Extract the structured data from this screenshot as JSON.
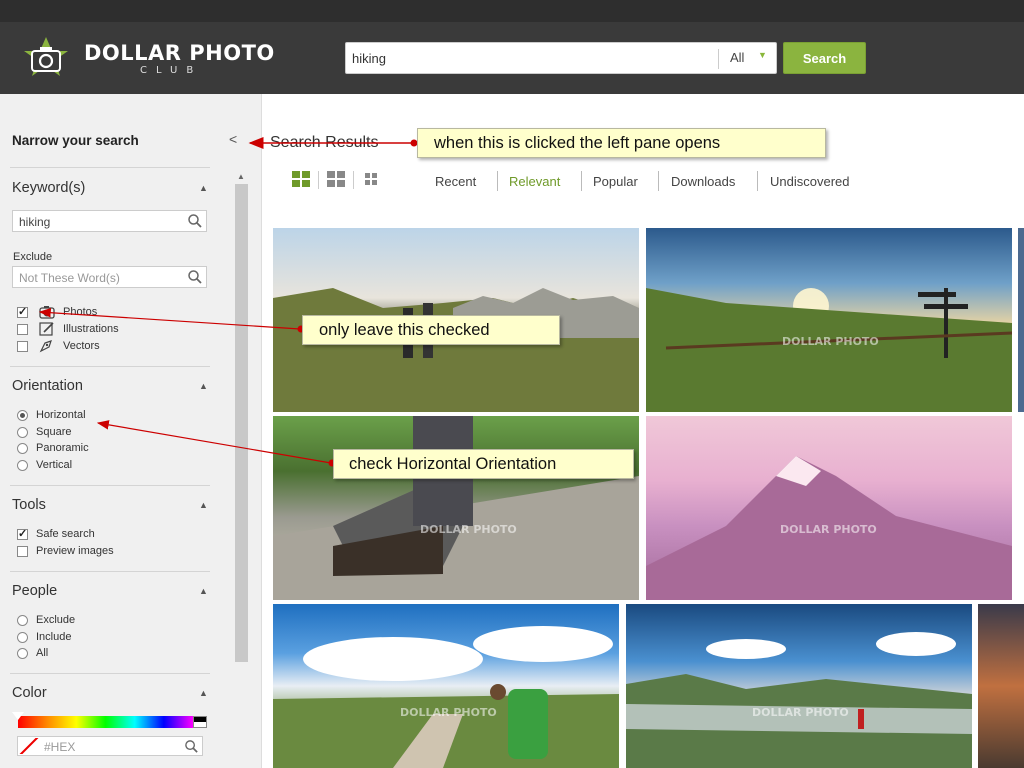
{
  "header": {
    "logo_title": "DOLLAR PHOTO",
    "logo_sub": "CLUB",
    "search_value": "hiking",
    "category_value": "All",
    "search_button": "Search"
  },
  "sidebar": {
    "title": "Narrow your search",
    "keywords": {
      "title": "Keyword(s)",
      "value": "hiking",
      "exclude_label": "Exclude",
      "exclude_placeholder": "Not These Word(s)"
    },
    "types": [
      {
        "label": "Photos",
        "checked": true,
        "icon": "camera-icon"
      },
      {
        "label": "Illustrations",
        "checked": false,
        "icon": "pencil-icon"
      },
      {
        "label": "Vectors",
        "checked": false,
        "icon": "pen-nib-icon"
      }
    ],
    "orientation": {
      "title": "Orientation",
      "options": [
        "Horizontal",
        "Square",
        "Panoramic",
        "Vertical"
      ],
      "selected": "Horizontal"
    },
    "tools": {
      "title": "Tools",
      "options": [
        {
          "label": "Safe search",
          "checked": true
        },
        {
          "label": "Preview images",
          "checked": false
        }
      ]
    },
    "people": {
      "title": "People",
      "options": [
        "Exclude",
        "Include",
        "All"
      ]
    },
    "color": {
      "title": "Color",
      "hex_placeholder": "#HEX"
    }
  },
  "main": {
    "title": "Search Results",
    "sort_options": [
      "Recent",
      "Relevant",
      "Popular",
      "Downloads",
      "Undiscovered"
    ],
    "active_sort": "Relevant",
    "watermark": "DOLLAR PHOTO"
  },
  "annotations": {
    "pane": "when this is clicked the left pane opens",
    "photos": "only leave this checked",
    "orientation": "check Horizontal Orientation"
  },
  "colors": {
    "header_bg": "#3a3a3a",
    "accent_green": "#8bb43f",
    "callout_bg": "#ffffcc",
    "arrow_red": "#cc0000"
  }
}
